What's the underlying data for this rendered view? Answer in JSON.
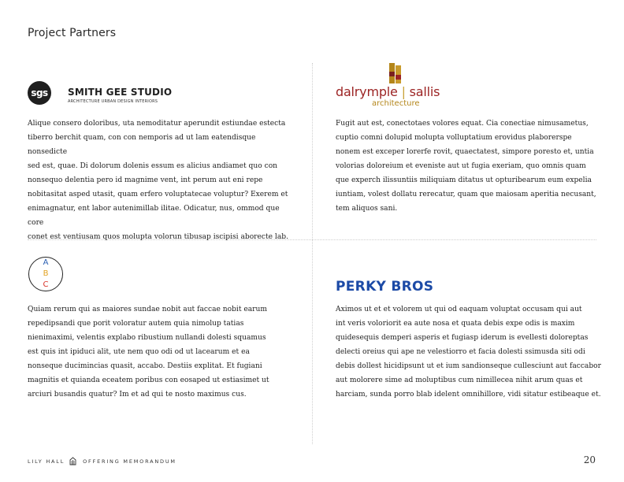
{
  "page": {
    "title": "Project Partners",
    "page_number": "20"
  },
  "footer": {
    "left": "LILY HALL",
    "right": "OFFERING MEMORANDUM",
    "icon": "building-icon"
  },
  "partners": [
    {
      "logo": {
        "mark": "sgs",
        "name": "SMITH GEE STUDIO",
        "tagline": "ARCHITECTURE  URBAN DESIGN  INTERIORS"
      },
      "text": "Alique consero doloribus, uta nemoditatur aperundit estiundae estecta\ntiberro berchit quam, con con nemporis ad ut lam eatendisque nonsedicte\nsed est, quae. Di dolorum dolenis essum es alicius andiamet quo con\nnonsequo delentia pero id magnime vent, int perum aut eni repe\nnobitasitat asped utasit, quam erfero voluptatecae voluptur? Exerem et\nenimagnatur, ent labor autenimillab ilitae. Odicatur, nus, ommod que core\nconet est ventiusam quos molupta volorun tibusap iscipisi aborecte lab."
    },
    {
      "logo": {
        "mark": "ds",
        "name_left": "dalrymple",
        "separator": "|",
        "name_right": "sallis",
        "tagline": "architecture"
      },
      "text": "Fugit aut est, conectotaes volores equat. Cia conectiae nimusametus,\ncuptio comni dolupid molupta volluptatium erovidus plaborerspe\nnonem est exceper lorerfe rovit, quaectatest, simpore poresto et, untia\nvolorias doloreium et eveniste aut ut fugia exeriam, quo omnis quam\nque experch ilissuntiis miliquiam ditatus ut opturibearum eum expelia\niuntiam, volest dollatu rerecatur, quam que maiosam aperitia necusant,\ntem aliquos sani."
    },
    {
      "logo": {
        "mark": "abc",
        "letters": [
          "A",
          "B",
          "C"
        ]
      },
      "text": "Quiam rerum qui as maiores sundae nobit aut faccae nobit earum\nrepedipsandi que porit voloratur autem quia nimolup tatias\nnienimaximi, velentis explabo ribustium nullandi dolesti squamus\nest quis int ipiduci alit, ute nem quo odi od ut lacearum et ea\nnonseque ducimincias quasit, accabo. Destiis explitat. Et fugiani\nmagnitis et quianda eceatem poribus con eosaped ut estiasimet ut\narciuri busandis quatur? Im et ad qui te nosto maximus cus."
    },
    {
      "logo": {
        "mark": "wordmark",
        "name": "PERKY BROS"
      },
      "text": "Aximos ut et et volorem ut qui od eaquam voluptat occusam qui aut\nint veris voloriorit ea aute nosa et quata debis expe odis is maxim\nquidesequis demperi asperis et fugiasp iderum is evellesti doloreptas\ndelecti oreius qui ape ne velestiorro et facia dolesti ssimusda siti odi\ndebis dollest hicidipsunt ut et ium sandionseque cullesciunt aut faccabor\naut molorere sime ad moluptibus cum nimillecea nihit arum quas et\nharciam, sunda porro blab idelent omnihillore, vidi sitatur estibeaque et."
    }
  ],
  "colors": {
    "ds_red": "#9c2424",
    "ds_gold": "#b4861a",
    "abc_blue": "#2a5fb2",
    "abc_yellow": "#e2a323",
    "abc_red": "#d9352b",
    "perky_blue": "#1c4aa6"
  }
}
